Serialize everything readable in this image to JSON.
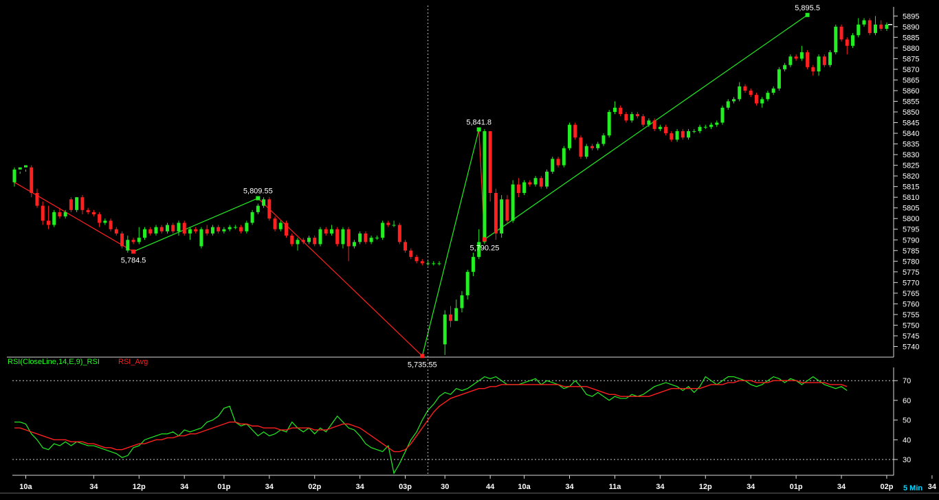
{
  "chart_data": {
    "type": "candlestick",
    "timeframe": "5 Min",
    "price_axis": {
      "min": 5735,
      "max": 5898,
      "ticks": [
        5895,
        5890,
        5885,
        5880,
        5875,
        5870,
        5865,
        5860,
        5855,
        5850,
        5845,
        5840,
        5835,
        5830,
        5825,
        5820,
        5815,
        5810,
        5805,
        5800,
        5795,
        5790,
        5785,
        5780,
        5775,
        5770,
        5765,
        5760,
        5755,
        5750,
        5745,
        5740
      ]
    },
    "rsi_axis": {
      "min": 22,
      "max": 76,
      "ticks": [
        70,
        60,
        50,
        40,
        30
      ],
      "reference_levels": [
        70,
        30
      ]
    },
    "x_tick_labels": [
      "10a",
      "34",
      "12p",
      "34",
      "01p",
      "34",
      "02p",
      "34",
      "03p",
      "30",
      "44",
      "10a",
      "34",
      "11a",
      "34",
      "12p",
      "34",
      "01p",
      "34",
      "02p",
      "34"
    ],
    "x_tick_index": [
      2,
      14,
      22,
      30,
      37,
      45,
      53,
      61,
      69,
      76,
      84,
      90,
      98,
      106,
      114,
      122,
      130,
      138,
      146,
      154,
      162
    ],
    "candles": [
      [
        5817,
        5823,
        5824,
        5815
      ],
      [
        5823,
        5824,
        5822,
        5821
      ],
      [
        5824,
        5825,
        5823,
        5822
      ],
      [
        5824,
        5812,
        5825,
        5810
      ],
      [
        5812,
        5806,
        5814,
        5805
      ],
      [
        5806,
        5799,
        5808,
        5797
      ],
      [
        5799,
        5797,
        5806,
        5795
      ],
      [
        5797,
        5803,
        5804,
        5796
      ],
      [
        5803,
        5801,
        5805,
        5800
      ],
      [
        5801,
        5803,
        5804,
        5800
      ],
      [
        5809,
        5804,
        5810,
        5803
      ],
      [
        5804,
        5810,
        5810,
        5803
      ],
      [
        5810,
        5804,
        5811,
        5802
      ],
      [
        5804,
        5803,
        5805,
        5802
      ],
      [
        5803,
        5802,
        5804,
        5801
      ],
      [
        5802,
        5798,
        5803,
        5796
      ],
      [
        5798,
        5799,
        5800,
        5797
      ],
      [
        5799,
        5795,
        5800,
        5794
      ],
      [
        5795,
        5793,
        5796,
        5792
      ],
      [
        5793,
        5787,
        5794,
        5786
      ],
      [
        5785,
        5790,
        5792,
        5784
      ],
      [
        5790,
        5789,
        5791,
        5788
      ],
      [
        5789,
        5791,
        5796,
        5788
      ],
      [
        5791,
        5795,
        5796,
        5790
      ],
      [
        5795,
        5793,
        5796,
        5792
      ],
      [
        5793,
        5796,
        5797,
        5792
      ],
      [
        5796,
        5794,
        5797,
        5793
      ],
      [
        5794,
        5797,
        5798,
        5793
      ],
      [
        5797,
        5794,
        5798,
        5793
      ],
      [
        5794,
        5798,
        5799,
        5792
      ],
      [
        5798,
        5793,
        5799,
        5792
      ],
      [
        5793,
        5795,
        5796,
        5790
      ],
      [
        5795,
        5794,
        5796,
        5793
      ],
      [
        5787,
        5795,
        5796,
        5786
      ],
      [
        5795,
        5793,
        5797,
        5792
      ],
      [
        5793,
        5796,
        5797,
        5792
      ],
      [
        5796,
        5794,
        5797,
        5793
      ],
      [
        5794,
        5795,
        5796,
        5793
      ],
      [
        5795,
        5796,
        5797,
        5794
      ],
      [
        5796,
        5796,
        5797,
        5795
      ],
      [
        5796,
        5794,
        5797,
        5793
      ],
      [
        5794,
        5798,
        5799,
        5793
      ],
      [
        5798,
        5803,
        5804,
        5797
      ],
      [
        5803,
        5806,
        5807,
        5802
      ],
      [
        5806,
        5809,
        5810,
        5805
      ],
      [
        5809,
        5800,
        5810,
        5799
      ],
      [
        5800,
        5795,
        5801,
        5794
      ],
      [
        5795,
        5798,
        5799,
        5794
      ],
      [
        5798,
        5792,
        5799,
        5791
      ],
      [
        5792,
        5788,
        5793,
        5787
      ],
      [
        5788,
        5790,
        5791,
        5785
      ],
      [
        5790,
        5789,
        5791,
        5788
      ],
      [
        5789,
        5791,
        5792,
        5788
      ],
      [
        5791,
        5788,
        5792,
        5787
      ],
      [
        5788,
        5795,
        5796,
        5787
      ],
      [
        5795,
        5793,
        5796,
        5792
      ],
      [
        5793,
        5795,
        5797,
        5792
      ],
      [
        5795,
        5788,
        5796,
        5787
      ],
      [
        5788,
        5795,
        5796,
        5786
      ],
      [
        5795,
        5787,
        5796,
        5780
      ],
      [
        5787,
        5789,
        5790,
        5786
      ],
      [
        5789,
        5793,
        5794,
        5788
      ],
      [
        5793,
        5789,
        5794,
        5788
      ],
      [
        5789,
        5791,
        5792,
        5788
      ],
      [
        5791,
        5791,
        5792,
        5790
      ],
      [
        5791,
        5798,
        5799,
        5790
      ],
      [
        5798,
        5797,
        5799,
        5796
      ],
      [
        5797,
        5797,
        5799,
        5796
      ],
      [
        5797,
        5789,
        5798,
        5788
      ],
      [
        5789,
        5785,
        5790,
        5784
      ],
      [
        5785,
        5782,
        5786,
        5781
      ],
      [
        5782,
        5780,
        5783,
        5779
      ],
      [
        5780,
        5779,
        5781,
        5778
      ],
      [
        5779,
        5779,
        5780,
        5778
      ],
      [
        5779,
        5779,
        5780,
        5778
      ],
      [
        5779,
        5779,
        5780,
        5778
      ],
      [
        5741,
        5755,
        5757,
        5736
      ],
      [
        5755,
        5752,
        5759,
        5749
      ],
      [
        5752,
        5758,
        5762,
        5752
      ],
      [
        5758,
        5764,
        5766,
        5756
      ],
      [
        5764,
        5775,
        5776,
        5762
      ],
      [
        5775,
        5782,
        5784,
        5773
      ],
      [
        5782,
        5789,
        5795,
        5781
      ],
      [
        5789,
        5841,
        5842,
        5788
      ],
      [
        5841,
        5812,
        5815,
        5808
      ],
      [
        5812,
        5793,
        5814,
        5790
      ],
      [
        5793,
        5809,
        5811,
        5791
      ],
      [
        5809,
        5799,
        5811,
        5798
      ],
      [
        5799,
        5816,
        5818,
        5798
      ],
      [
        5816,
        5812,
        5819,
        5810
      ],
      [
        5812,
        5817,
        5818,
        5811
      ],
      [
        5817,
        5816,
        5818,
        5815
      ],
      [
        5816,
        5819,
        5820,
        5815
      ],
      [
        5819,
        5815,
        5820,
        5814
      ],
      [
        5815,
        5822,
        5823,
        5814
      ],
      [
        5822,
        5828,
        5829,
        5821
      ],
      [
        5828,
        5825,
        5829,
        5824
      ],
      [
        5825,
        5833,
        5834,
        5824
      ],
      [
        5833,
        5844,
        5845,
        5832
      ],
      [
        5844,
        5838,
        5845,
        5837
      ],
      [
        5838,
        5829,
        5839,
        5828
      ],
      [
        5829,
        5834,
        5835,
        5828
      ],
      [
        5834,
        5833,
        5835,
        5832
      ],
      [
        5833,
        5835,
        5836,
        5832
      ],
      [
        5835,
        5839,
        5840,
        5834
      ],
      [
        5839,
        5850,
        5851,
        5838
      ],
      [
        5850,
        5852,
        5855,
        5849
      ],
      [
        5852,
        5849,
        5853,
        5848
      ],
      [
        5849,
        5846,
        5850,
        5845
      ],
      [
        5846,
        5849,
        5850,
        5845
      ],
      [
        5849,
        5848,
        5850,
        5847
      ],
      [
        5848,
        5844,
        5849,
        5843
      ],
      [
        5844,
        5846,
        5847,
        5843
      ],
      [
        5846,
        5842,
        5847,
        5841
      ],
      [
        5842,
        5843,
        5844,
        5841
      ],
      [
        5843,
        5840,
        5844,
        5839
      ],
      [
        5840,
        5837,
        5841,
        5836
      ],
      [
        5837,
        5841,
        5842,
        5836
      ],
      [
        5841,
        5838,
        5842,
        5837
      ],
      [
        5838,
        5841,
        5842,
        5837
      ],
      [
        5841,
        5841,
        5842,
        5840
      ],
      [
        5841,
        5843,
        5844,
        5840
      ],
      [
        5843,
        5843,
        5844,
        5842
      ],
      [
        5843,
        5844,
        5845,
        5842
      ],
      [
        5844,
        5845,
        5846,
        5843
      ],
      [
        5845,
        5852,
        5853,
        5844
      ],
      [
        5852,
        5855,
        5856,
        5851
      ],
      [
        5855,
        5856,
        5857,
        5854
      ],
      [
        5856,
        5862,
        5864,
        5855
      ],
      [
        5862,
        5860,
        5863,
        5859
      ],
      [
        5860,
        5858,
        5861,
        5857
      ],
      [
        5858,
        5854,
        5859,
        5853
      ],
      [
        5854,
        5856,
        5857,
        5852
      ],
      [
        5856,
        5859,
        5860,
        5855
      ],
      [
        5859,
        5861,
        5862,
        5858
      ],
      [
        5861,
        5870,
        5871,
        5860
      ],
      [
        5870,
        5872,
        5873,
        5869
      ],
      [
        5872,
        5876,
        5877,
        5871
      ],
      [
        5876,
        5875,
        5877,
        5874
      ],
      [
        5875,
        5878,
        5881,
        5874
      ],
      [
        5878,
        5871,
        5879,
        5870
      ],
      [
        5871,
        5869,
        5872,
        5867
      ],
      [
        5869,
        5876,
        5877,
        5867
      ],
      [
        5876,
        5872,
        5877,
        5871
      ],
      [
        5872,
        5878,
        5879,
        5871
      ],
      [
        5878,
        5890,
        5891,
        5877
      ],
      [
        5890,
        5884,
        5891,
        5883
      ],
      [
        5884,
        5881,
        5885,
        5877
      ],
      [
        5881,
        5886,
        5887,
        5880
      ],
      [
        5886,
        5891,
        5894,
        5885
      ],
      [
        5891,
        5893,
        5894,
        5890
      ],
      [
        5893,
        5887,
        5894,
        5886
      ],
      [
        5887,
        5891,
        5895,
        5886
      ],
      [
        5891,
        5889,
        5893,
        5888
      ],
      [
        5889,
        5891,
        5892,
        5888
      ]
    ],
    "rsi": [
      49,
      49,
      48,
      43,
      40,
      36,
      35,
      38,
      37,
      39,
      37,
      39,
      38,
      37,
      37,
      36,
      35,
      34,
      33,
      31,
      32,
      36,
      37,
      40,
      41,
      42,
      43,
      43,
      44,
      42,
      45,
      44,
      45,
      46,
      49,
      50,
      52,
      56,
      57,
      49,
      47,
      48,
      45,
      42,
      44,
      42,
      43,
      45,
      44,
      49,
      46,
      44,
      46,
      43,
      46,
      44,
      48,
      52,
      49,
      46,
      45,
      42,
      38,
      36,
      35,
      34,
      37,
      23,
      28,
      34,
      40,
      44,
      50,
      55,
      58,
      62,
      64,
      63,
      66,
      65,
      66,
      68,
      70,
      72,
      71,
      72,
      70,
      68,
      68,
      68,
      69,
      70,
      71,
      68,
      70,
      69,
      68,
      66,
      67,
      70,
      67,
      63,
      62,
      64,
      62,
      60,
      62,
      61,
      61,
      63,
      62,
      63,
      65,
      67,
      68,
      69,
      68,
      67,
      65,
      67,
      64,
      67,
      72,
      70,
      68,
      70,
      72,
      72,
      71,
      70,
      68,
      67,
      68,
      70,
      72,
      71,
      69,
      71,
      70,
      68,
      70,
      72,
      70,
      68,
      67,
      66,
      67,
      65
    ],
    "rsi_avg": [
      46,
      46,
      45,
      44,
      43,
      42,
      41,
      40,
      40,
      40,
      39,
      39,
      39,
      38,
      38,
      37,
      36,
      36,
      35,
      35,
      36,
      37,
      38,
      38,
      39,
      40,
      40,
      41,
      41,
      42,
      42,
      43,
      43,
      44,
      45,
      46,
      47,
      48,
      49,
      49,
      48,
      48,
      47,
      47,
      46,
      46,
      46,
      45,
      45,
      46,
      46,
      46,
      46,
      45,
      45,
      45,
      46,
      47,
      48,
      48,
      47,
      46,
      44,
      42,
      40,
      38,
      36,
      34,
      34,
      35,
      38,
      42,
      46,
      50,
      54,
      57,
      59,
      61,
      62,
      63,
      64,
      65,
      66,
      66,
      67,
      67,
      68,
      68,
      68,
      68,
      68,
      68,
      68,
      68,
      68,
      68,
      68,
      67,
      67,
      67,
      67,
      67,
      66,
      65,
      64,
      63,
      63,
      62,
      62,
      62,
      62,
      62,
      62,
      63,
      64,
      65,
      66,
      66,
      66,
      66,
      66,
      66,
      67,
      68,
      68,
      68,
      69,
      69,
      70,
      70,
      70,
      69,
      69,
      69,
      70,
      70,
      70,
      70,
      70,
      69,
      69,
      69,
      69,
      69,
      68,
      68,
      68,
      67
    ],
    "pivots": [
      {
        "index": 0,
        "price": 5817
      },
      {
        "index": 21,
        "price": 5784.5,
        "label": "5,784.5",
        "pos": "below"
      },
      {
        "index": 43,
        "price": 5809.55,
        "label": "5,809.55",
        "pos": "above"
      },
      {
        "index": 72,
        "price": 5735.55,
        "label": "5,735.55",
        "pos": "below"
      },
      {
        "index": 82,
        "price": 5841.8,
        "label": "5,841.8",
        "pos": "above"
      },
      {
        "index": 83,
        "price": 5790.25,
        "label": "5,790.25",
        "pos": "below"
      },
      {
        "index": 140,
        "price": 5895.5,
        "label": "5,895.5",
        "pos": "above"
      }
    ],
    "cursor_index": 73,
    "indicator_label": "RSI(CloseLine,14,E,9)_RSI",
    "indicator_avg_label": "RSI_Avg",
    "colors": {
      "up": "#22ee22",
      "down": "#ff2020",
      "rsi": "#22ee22",
      "rsi_avg": "#ff2020",
      "zigzag_up": "#22ee22",
      "zigzag_down": "#ff2020"
    }
  }
}
